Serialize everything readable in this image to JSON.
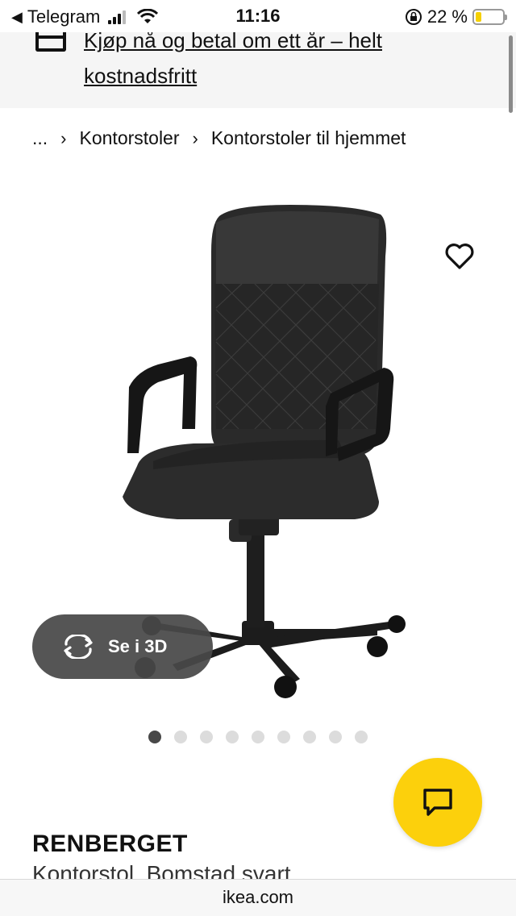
{
  "status_bar": {
    "back_app": "Telegram",
    "time": "11:16",
    "battery": "22 %",
    "battery_level": 0.22
  },
  "promo": {
    "text_line1": "Kjøp nå og betal om ett år – helt",
    "text_line2": "kostnadsfritt",
    "icon": "credit-card-icon"
  },
  "breadcrumb": {
    "ellipsis": "...",
    "separator": "›",
    "items": [
      "Kontorstoler",
      "Kontorstoler til hjemmet"
    ]
  },
  "product": {
    "name": "RENBERGET",
    "description": "Kontorstol, Bomstad svart"
  },
  "gallery": {
    "view_3d_label": "Se i 3D",
    "image_count": 9,
    "active_index": 0
  },
  "url_bar": {
    "domain": "ikea.com"
  },
  "colors": {
    "accent_yellow": "#fcd00c",
    "pill_dark": "#484848"
  }
}
